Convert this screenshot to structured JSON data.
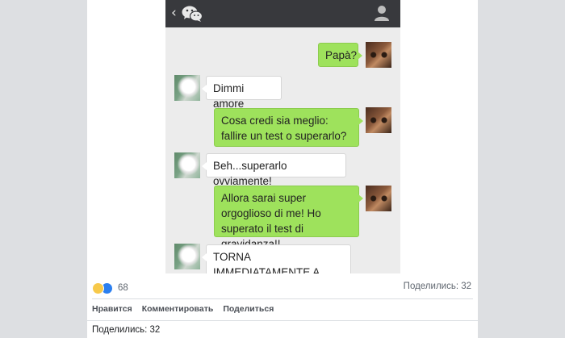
{
  "chat": {
    "header": {
      "back_icon": "chevron-left-icon",
      "app_icon": "wechat-icon",
      "profile_icon": "user-icon"
    },
    "messages": [
      {
        "side": "out",
        "text": "Papà?"
      },
      {
        "side": "in",
        "text": "Dimmi amore"
      },
      {
        "side": "out",
        "text": "Cosa credi sia meglio: fallire un test o superarlo?"
      },
      {
        "side": "in",
        "text": "Beh...superarlo ovviamente!"
      },
      {
        "side": "out",
        "text": "Allora sarai super orgoglioso di me! Ho superato il test di gravidanza!!"
      },
      {
        "side": "in",
        "text": "TORNA IMMEDIATAMENTE A CASA!!!!"
      }
    ]
  },
  "post": {
    "reaction_count": "68",
    "shares_summary": "Поделились: 32",
    "actions": {
      "like": "Нравится",
      "comment": "Комментировать",
      "share": "Поделиться"
    },
    "shares_footer": "Поделились: 32",
    "colors": {
      "bubble_out": "#9ee25c",
      "bubble_in": "#ffffff",
      "header": "#38393d",
      "like_blue": "#2b7ff0",
      "haha_yellow": "#f7c94a"
    }
  }
}
